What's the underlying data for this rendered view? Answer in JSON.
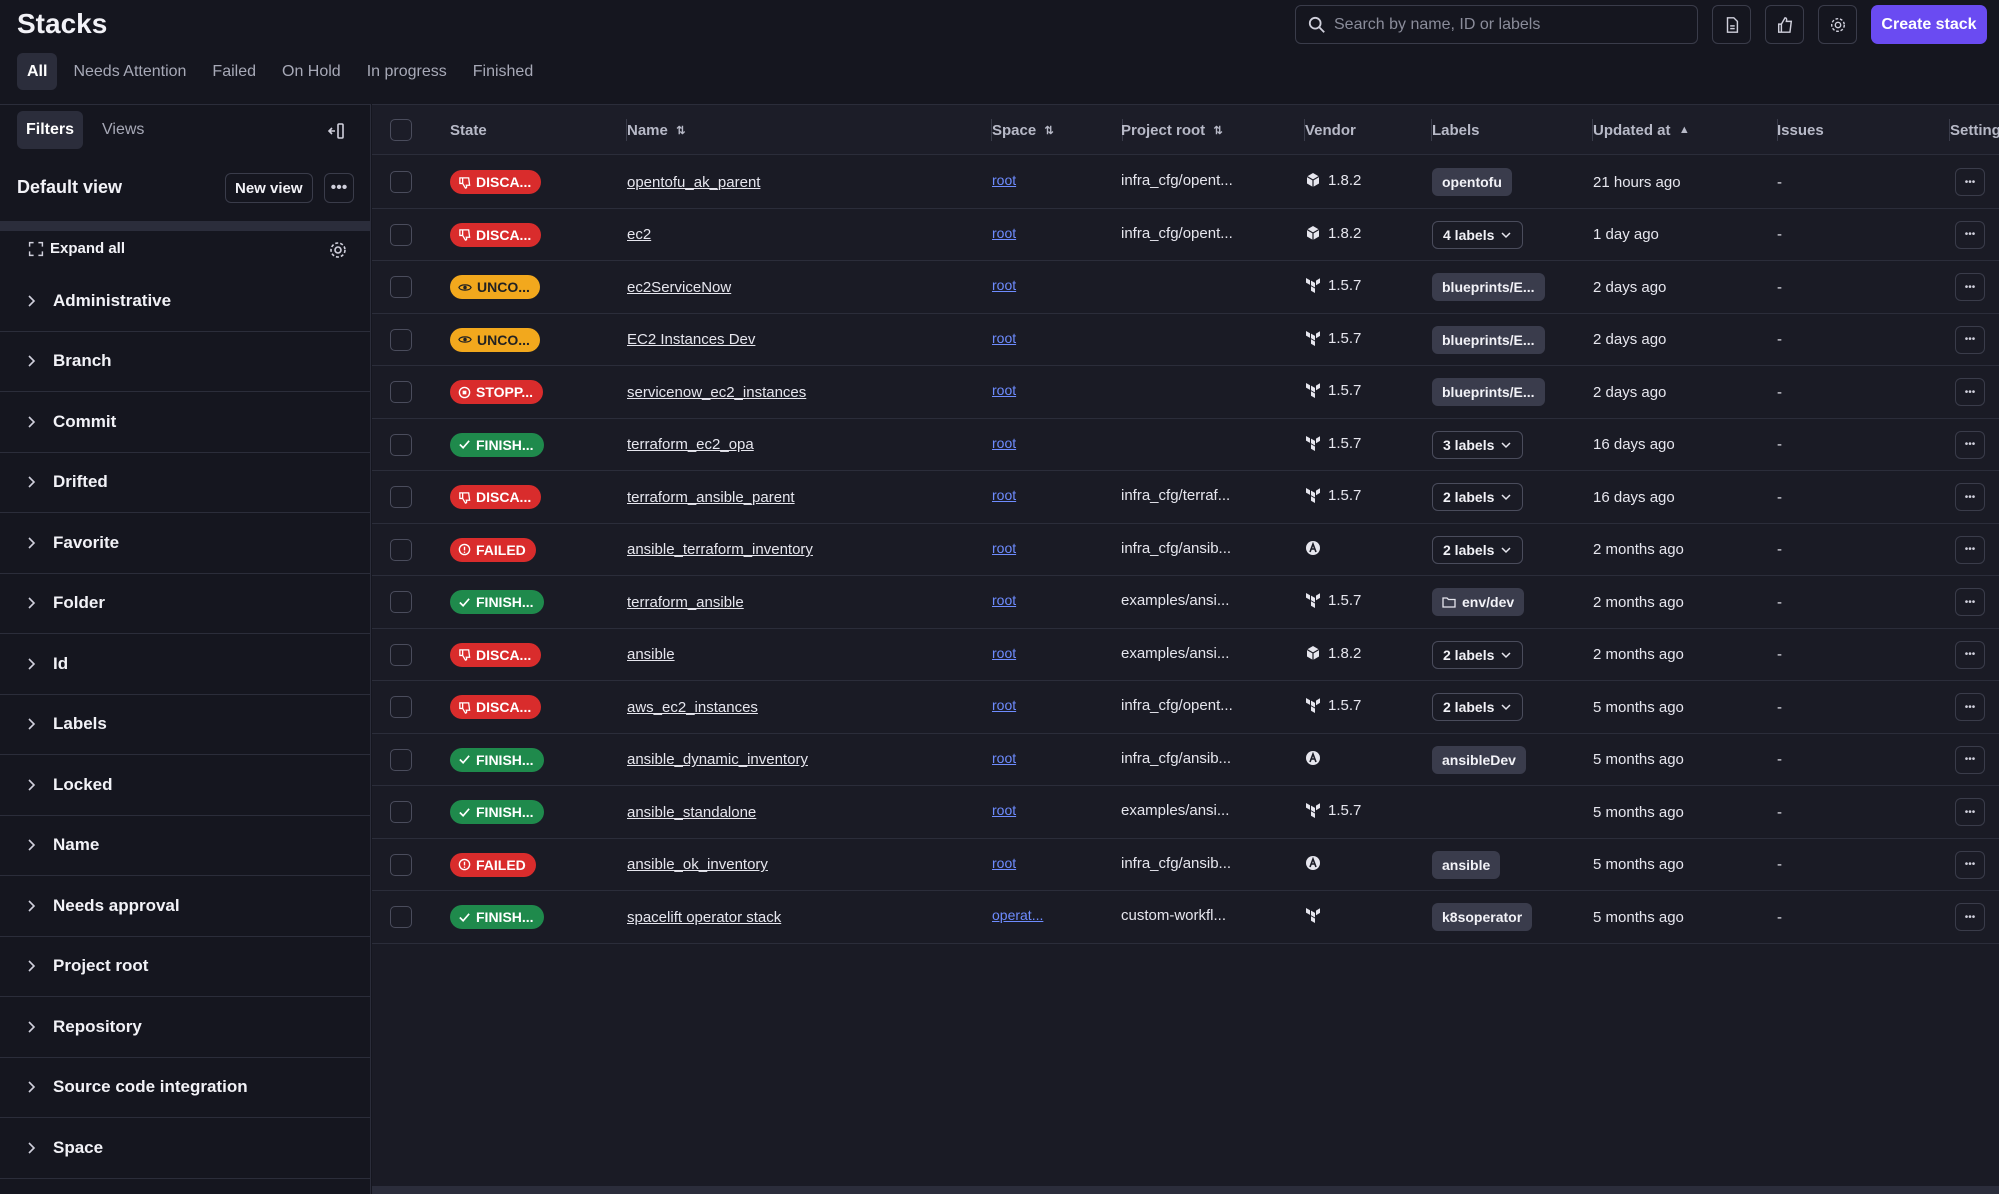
{
  "header": {
    "title": "Stacks",
    "search_placeholder": "Search by name, ID or labels",
    "create_label": "Create stack"
  },
  "tabs": [
    "All",
    "Needs Attention",
    "Failed",
    "On Hold",
    "In progress",
    "Finished"
  ],
  "sidebar": {
    "tabs": [
      "Filters",
      "Views"
    ],
    "view_title": "Default view",
    "new_view_label": "New view",
    "expand_all_label": "Expand all",
    "filters": [
      "Administrative",
      "Branch",
      "Commit",
      "Drifted",
      "Favorite",
      "Folder",
      "Id",
      "Labels",
      "Locked",
      "Name",
      "Needs approval",
      "Project root",
      "Repository",
      "Source code integration",
      "Space"
    ]
  },
  "table": {
    "columns": [
      "State",
      "Name",
      "Space",
      "Project root",
      "Vendor",
      "Labels",
      "Updated at",
      "Issues",
      "Settings"
    ],
    "rows": [
      {
        "state": "DISCA...",
        "status": "discarded",
        "name": "opentofu_ak_parent",
        "space": "root",
        "project_root": "infra_cfg/opent...",
        "vendor": "opentofu",
        "version": "1.8.2",
        "label": "opentofu",
        "label_kind": "tag",
        "updated": "21 hours ago",
        "issues": "-"
      },
      {
        "state": "DISCA...",
        "status": "discarded",
        "name": "ec2",
        "space": "root",
        "project_root": "infra_cfg/opent...",
        "vendor": "opentofu",
        "version": "1.8.2",
        "label": "4 labels",
        "label_kind": "drop",
        "updated": "1 day ago",
        "issues": "-"
      },
      {
        "state": "UNCO...",
        "status": "unconfirmed",
        "name": "ec2ServiceNow",
        "space": "root",
        "project_root": "",
        "vendor": "terraform",
        "version": "1.5.7",
        "label": "blueprints/E...",
        "label_kind": "tag",
        "updated": "2 days ago",
        "issues": "-"
      },
      {
        "state": "UNCO...",
        "status": "unconfirmed",
        "name": "EC2 Instances Dev",
        "space": "root",
        "project_root": "",
        "vendor": "terraform",
        "version": "1.5.7",
        "label": "blueprints/E...",
        "label_kind": "tag",
        "updated": "2 days ago",
        "issues": "-"
      },
      {
        "state": "STOPP...",
        "status": "stopped",
        "name": "servicenow_ec2_instances",
        "space": "root",
        "project_root": "",
        "vendor": "terraform",
        "version": "1.5.7",
        "label": "blueprints/E...",
        "label_kind": "tag",
        "updated": "2 days ago",
        "issues": "-"
      },
      {
        "state": "FINISH...",
        "status": "finished",
        "name": "terraform_ec2_opa",
        "space": "root",
        "project_root": "",
        "vendor": "terraform",
        "version": "1.5.7",
        "label": "3 labels",
        "label_kind": "drop",
        "updated": "16 days ago",
        "issues": "-"
      },
      {
        "state": "DISCA...",
        "status": "discarded",
        "name": "terraform_ansible_parent",
        "space": "root",
        "project_root": "infra_cfg/terraf...",
        "vendor": "terraform",
        "version": "1.5.7",
        "label": "2 labels",
        "label_kind": "drop",
        "updated": "16 days ago",
        "issues": "-"
      },
      {
        "state": "FAILED",
        "status": "failed",
        "name": "ansible_terraform_inventory",
        "space": "root",
        "project_root": "infra_cfg/ansib...",
        "vendor": "ansible",
        "version": "",
        "label": "2 labels",
        "label_kind": "drop",
        "updated": "2 months ago",
        "issues": "-"
      },
      {
        "state": "FINISH...",
        "status": "finished",
        "name": "terraform_ansible",
        "space": "root",
        "project_root": "examples/ansi...",
        "vendor": "terraform",
        "version": "1.5.7",
        "label": "env/dev",
        "label_kind": "folder",
        "updated": "2 months ago",
        "issues": "-"
      },
      {
        "state": "DISCA...",
        "status": "discarded",
        "name": "ansible",
        "space": "root",
        "project_root": "examples/ansi...",
        "vendor": "opentofu",
        "version": "1.8.2",
        "label": "2 labels",
        "label_kind": "drop",
        "updated": "2 months ago",
        "issues": "-"
      },
      {
        "state": "DISCA...",
        "status": "discarded",
        "name": "aws_ec2_instances",
        "space": "root",
        "project_root": "infra_cfg/opent...",
        "vendor": "terraform",
        "version": "1.5.7",
        "label": "2 labels",
        "label_kind": "drop",
        "updated": "5 months ago",
        "issues": "-"
      },
      {
        "state": "FINISH...",
        "status": "finished",
        "name": "ansible_dynamic_inventory",
        "space": "root",
        "project_root": "infra_cfg/ansib...",
        "vendor": "ansible",
        "version": "",
        "label": "ansibleDev",
        "label_kind": "tag",
        "updated": "5 months ago",
        "issues": "-"
      },
      {
        "state": "FINISH...",
        "status": "finished",
        "name": "ansible_standalone",
        "space": "root",
        "project_root": "examples/ansi...",
        "vendor": "terraform",
        "version": "1.5.7",
        "label": "",
        "label_kind": "none",
        "updated": "5 months ago",
        "issues": "-"
      },
      {
        "state": "FAILED",
        "status": "failed",
        "name": "ansible_ok_inventory",
        "space": "root",
        "project_root": "infra_cfg/ansib...",
        "vendor": "ansible",
        "version": "",
        "label": "ansible",
        "label_kind": "tag",
        "updated": "5 months ago",
        "issues": "-"
      },
      {
        "state": "FINISH...",
        "status": "finished",
        "name": "spacelift operator stack",
        "space": "operat...",
        "project_root": "custom-workfl...",
        "vendor": "terraform",
        "version": "",
        "label": "k8soperator",
        "label_kind": "tag",
        "updated": "5 months ago",
        "issues": "-"
      }
    ]
  },
  "colors": {
    "discarded": "#d92c2c",
    "failed": "#d92c2c",
    "stopped": "#d92c2c",
    "unconfirmed": "#f2a81d",
    "finished": "#1f8a4c",
    "accent": "#6a4bf2",
    "space_link": "#6e8cff"
  }
}
